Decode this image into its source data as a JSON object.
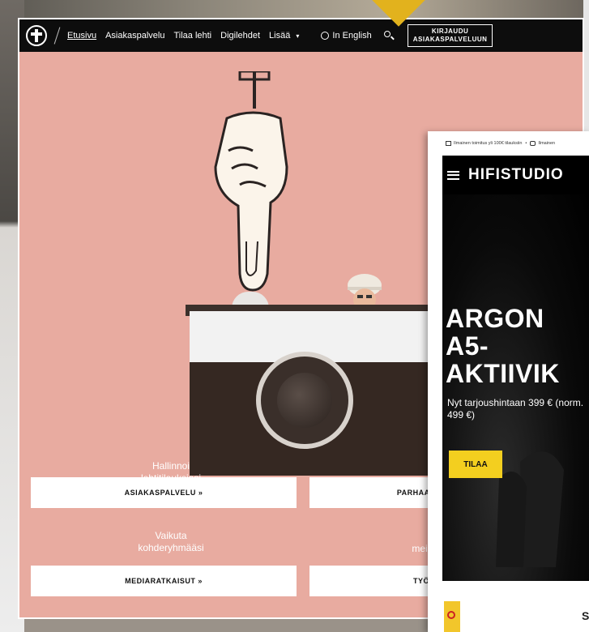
{
  "nav": {
    "items": [
      "Etusivu",
      "Asiakaspalvelu",
      "Tilaa lehti",
      "Digilehdet",
      "Lisää"
    ],
    "more_caret": "▾",
    "language": "In English",
    "login_line1": "KIRJAUDU",
    "login_line2": "ASIAKASPALVELUUN"
  },
  "hero": {
    "label_manage": "Hallinnoi\nlehtitilauksiasi",
    "label_influence": "Vaikuta\nkohderyhmääsi",
    "label_partial": "mei",
    "btn_customer_service": "ASIAKASPALVELU »",
    "btn_partial_right": "PARHAAT",
    "btn_media": "MEDIARATKAISUT »",
    "btn_partial_right2": "TYÖ"
  },
  "hifi": {
    "topbar_text1": "Ilmainen toimitus yli 100€ tilauksiin",
    "topbar_sep": "•",
    "topbar_text2": "Ilmainen",
    "logo": "HIFISTUDIO",
    "title": "ARGON\nA5-\nAKTIIVIK",
    "subtitle": "Nyt tarjoushintaan 399 € (norm. 499 €)",
    "order_label": "TILAA",
    "bottom_partial": "S"
  },
  "colors": {
    "hero_bg": "#e8aba0",
    "navbar_bg": "#0d0d0d",
    "accent_yellow": "#f3cf1f"
  }
}
